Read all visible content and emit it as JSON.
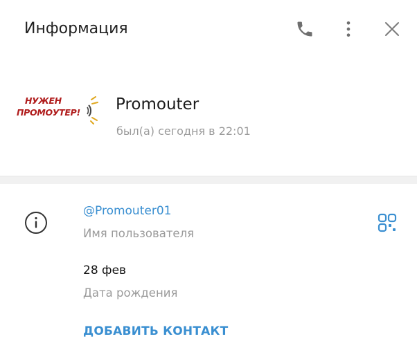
{
  "header": {
    "title": "Информация",
    "call_icon": "phone-icon",
    "more_icon": "more-vertical-icon",
    "close_icon": "close-icon"
  },
  "profile": {
    "avatar_text_line1": "НУЖЕН",
    "avatar_text_line2": "ПРОМОУТЕР!",
    "name": "Promouter",
    "status": "был(а) сегодня в 22:01"
  },
  "info": {
    "info_icon": "info-circle-icon",
    "username": "@Promouter01",
    "username_caption": "Имя пользователя",
    "qr_icon": "qr-code-icon",
    "birthday": "28 фев",
    "birthday_caption": "Дата рождения",
    "add_contact_label": "ДОБАВИТЬ КОНТАКТ"
  },
  "colors": {
    "accent": "#3a8fd1",
    "secondary_text": "#9a9a9a",
    "icon": "#6f6f6f",
    "logo_red": "#b01c1c",
    "logo_gold": "#e0a820"
  }
}
